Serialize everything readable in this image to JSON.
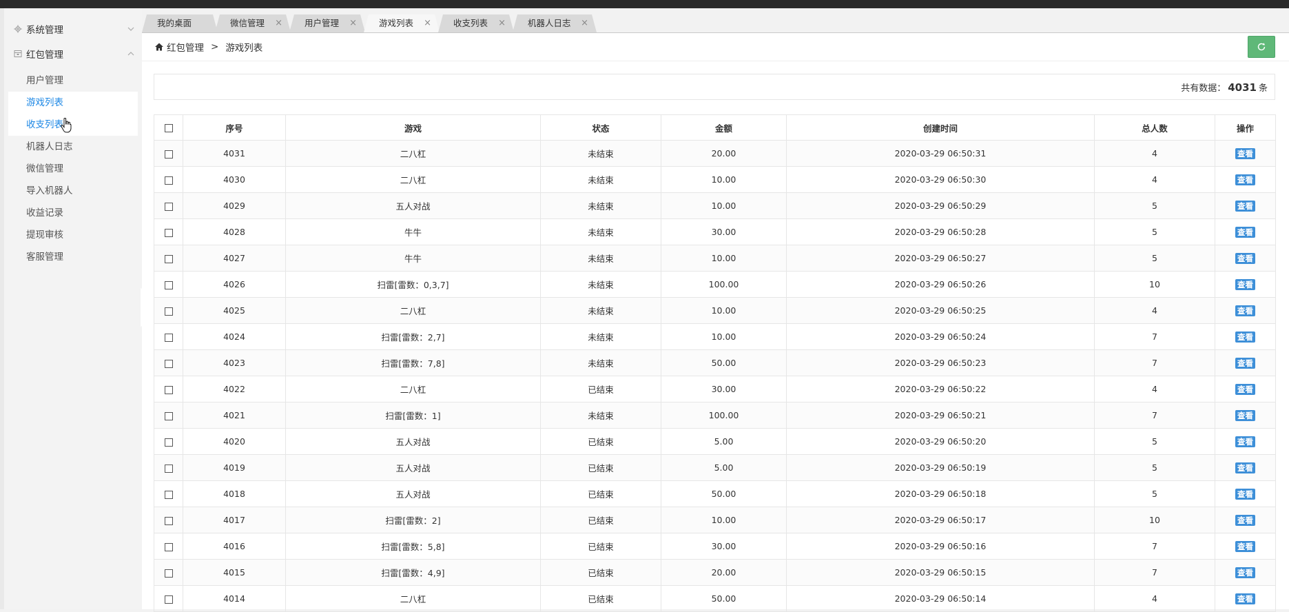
{
  "sidebar": {
    "groups": [
      {
        "label": "系统管理",
        "icon": "gear-icon"
      },
      {
        "label": "红包管理",
        "icon": "package-icon"
      }
    ],
    "items": [
      {
        "label": "用户管理"
      },
      {
        "label": "游戏列表"
      },
      {
        "label": "收支列表"
      },
      {
        "label": "机器人日志"
      },
      {
        "label": "微信管理"
      },
      {
        "label": "导入机器人"
      },
      {
        "label": "收益记录"
      },
      {
        "label": "提现审核"
      },
      {
        "label": "客服管理"
      }
    ],
    "active_item": "游戏列表"
  },
  "tabs": [
    {
      "label": "我的桌面",
      "closable": false
    },
    {
      "label": "微信管理",
      "closable": true
    },
    {
      "label": "用户管理",
      "closable": true
    },
    {
      "label": "游戏列表",
      "closable": true,
      "active": true
    },
    {
      "label": "收支列表",
      "closable": true
    },
    {
      "label": "机器人日志",
      "closable": true
    }
  ],
  "tab_close_glyph": "×",
  "breadcrumb": {
    "parent": "红包管理",
    "separator": ">",
    "current": "游戏列表"
  },
  "summary": {
    "prefix": "共有数据：",
    "count": "4031",
    "suffix": "条"
  },
  "table": {
    "headers": [
      "序号",
      "游戏",
      "状态",
      "金额",
      "创建时间",
      "总人数",
      "操作"
    ],
    "action_label": "查看",
    "rows": [
      [
        "4031",
        "二八杠",
        "未结束",
        "20.00",
        "2020-03-29 06:50:31",
        "4"
      ],
      [
        "4030",
        "二八杠",
        "未结束",
        "10.00",
        "2020-03-29 06:50:30",
        "4"
      ],
      [
        "4029",
        "五人对战",
        "未结束",
        "10.00",
        "2020-03-29 06:50:29",
        "5"
      ],
      [
        "4028",
        "牛牛",
        "未结束",
        "30.00",
        "2020-03-29 06:50:28",
        "5"
      ],
      [
        "4027",
        "牛牛",
        "未结束",
        "10.00",
        "2020-03-29 06:50:27",
        "5"
      ],
      [
        "4026",
        "扫雷[雷数：0,3,7]",
        "未结束",
        "100.00",
        "2020-03-29 06:50:26",
        "10"
      ],
      [
        "4025",
        "二八杠",
        "未结束",
        "10.00",
        "2020-03-29 06:50:25",
        "4"
      ],
      [
        "4024",
        "扫雷[雷数：2,7]",
        "未结束",
        "10.00",
        "2020-03-29 06:50:24",
        "7"
      ],
      [
        "4023",
        "扫雷[雷数：7,8]",
        "未结束",
        "50.00",
        "2020-03-29 06:50:23",
        "7"
      ],
      [
        "4022",
        "二八杠",
        "已结束",
        "30.00",
        "2020-03-29 06:50:22",
        "4"
      ],
      [
        "4021",
        "扫雷[雷数：1]",
        "未结束",
        "100.00",
        "2020-03-29 06:50:21",
        "7"
      ],
      [
        "4020",
        "五人对战",
        "已结束",
        "5.00",
        "2020-03-29 06:50:20",
        "5"
      ],
      [
        "4019",
        "五人对战",
        "已结束",
        "5.00",
        "2020-03-29 06:50:19",
        "5"
      ],
      [
        "4018",
        "五人对战",
        "已结束",
        "50.00",
        "2020-03-29 06:50:18",
        "5"
      ],
      [
        "4017",
        "扫雷[雷数：2]",
        "已结束",
        "10.00",
        "2020-03-29 06:50:17",
        "10"
      ],
      [
        "4016",
        "扫雷[雷数：5,8]",
        "已结束",
        "30.00",
        "2020-03-29 06:50:16",
        "7"
      ],
      [
        "4015",
        "扫雷[雷数：4,9]",
        "已结束",
        "20.00",
        "2020-03-29 06:50:15",
        "7"
      ],
      [
        "4014",
        "二八杠",
        "已结束",
        "50.00",
        "2020-03-29 06:50:14",
        "4"
      ]
    ]
  },
  "colors": {
    "accent": "#1e88e5",
    "refresh_button": "#5fb878",
    "view_button": "#3d8fd8"
  }
}
